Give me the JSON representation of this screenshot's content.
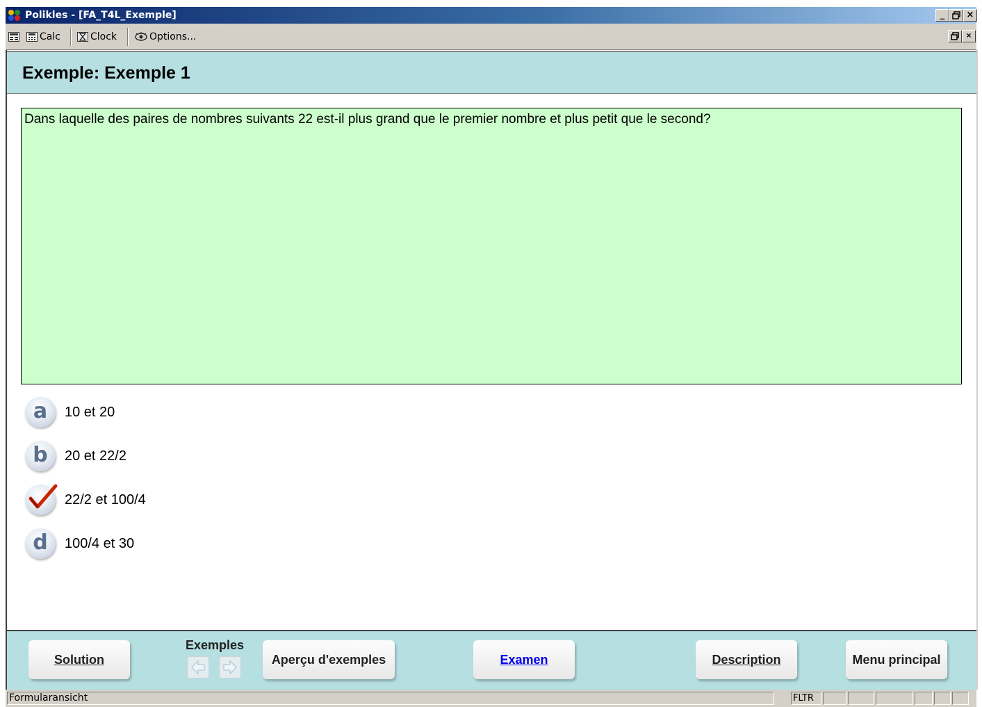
{
  "window": {
    "title": "Polikles - [FA_T4L_Exemple]",
    "minimize_label": "_",
    "restore_label": "❐",
    "close_label": "×"
  },
  "toolbar": {
    "calc_label": "Calc",
    "clock_label": "Clock",
    "options_label": "Options..."
  },
  "header": {
    "title": "Exemple: Exemple 1"
  },
  "question": {
    "text": "Dans laquelle des paires de nombres suivants 22 est-il plus grand que le premier nombre et plus petit que le second?"
  },
  "answers": [
    {
      "letter": "a",
      "text": "10 et 20",
      "checked": false
    },
    {
      "letter": "b",
      "text": "20 et 22/2",
      "checked": false
    },
    {
      "letter": "c",
      "text": "22/2 et 100/4",
      "checked": true
    },
    {
      "letter": "d",
      "text": "100/4 et 30",
      "checked": false
    }
  ],
  "footer": {
    "solution_label": "Solution",
    "exemples_label": "Exemples",
    "apercu_label": "Aperçu d'exemples",
    "examen_label": "Examen",
    "description_label": "Description",
    "menu_label": "Menu principal"
  },
  "status": {
    "text": "Formularansicht",
    "fltr": "FLTR"
  },
  "colors": {
    "header_bg": "#b6dfe2",
    "question_bg": "#ccffcc",
    "check": "#cc2200",
    "badge_letter": "#5a6f8e"
  }
}
